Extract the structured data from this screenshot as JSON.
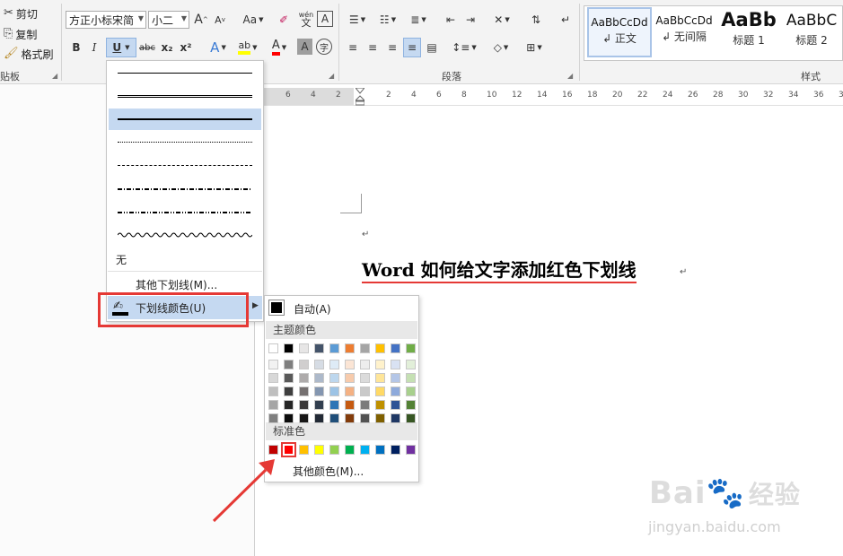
{
  "clipboard": {
    "cut": "剪切",
    "copy": "复制",
    "format_painter": "格式刷",
    "group_label": "贴板"
  },
  "font": {
    "name": "方正小标宋简",
    "size": "小二",
    "bold": "B",
    "italic": "I",
    "underline": "U",
    "strike": "abc",
    "subscript": "x₂",
    "superscript": "x²",
    "grow": "A",
    "shrink": "A",
    "change_case": "Aa",
    "phonetic": "wén",
    "char_border": "A",
    "text_effect": "A",
    "highlight": "ab",
    "font_color": "A",
    "char_shading": "A",
    "enclose": "字"
  },
  "paragraph": {
    "group_label": "段落"
  },
  "styles": {
    "group_label": "样式",
    "items": [
      {
        "sample": "AaBbCcDd",
        "name": "↲ 正文"
      },
      {
        "sample": "AaBbCcDd",
        "name": "↲ 无间隔"
      },
      {
        "sample": "AaBb",
        "name": "标题 1"
      },
      {
        "sample": "AaBbC",
        "name": "标题 2"
      }
    ]
  },
  "ruler": {
    "left_numbers": [
      "6",
      "4",
      "2"
    ],
    "right_numbers": [
      "2",
      "4",
      "6",
      "8",
      "10",
      "12",
      "14",
      "16",
      "18",
      "20",
      "22",
      "24",
      "26",
      "28",
      "30",
      "32",
      "34",
      "36",
      "38"
    ]
  },
  "underline_menu": {
    "none_label": "无",
    "more_label": "其他下划线(M)...",
    "color_label": "下划线颜色(U)"
  },
  "color_menu": {
    "auto_label": "自动(A)",
    "theme_title": "主题颜色",
    "standard_title": "标准色",
    "more_label": "其他颜色(M)...",
    "theme_top": [
      "#ffffff",
      "#000000",
      "#e7e6e6",
      "#44546a",
      "#5b9bd5",
      "#ed7d31",
      "#a5a5a5",
      "#ffc000",
      "#4472c4",
      "#70ad47"
    ],
    "theme_shades": [
      [
        "#f2f2f2",
        "#7f7f7f",
        "#d0cece",
        "#d6dce4",
        "#deebf6",
        "#fbe5d5",
        "#ededed",
        "#fff2cc",
        "#d9e2f3",
        "#e2efd9"
      ],
      [
        "#d8d8d8",
        "#595959",
        "#aeabab",
        "#adb9ca",
        "#bdd7ee",
        "#f7cbac",
        "#dbdbdb",
        "#fee599",
        "#b4c6e7",
        "#c5e0b3"
      ],
      [
        "#bfbfbf",
        "#3f3f3f",
        "#757070",
        "#8496b0",
        "#9cc3e5",
        "#f4b183",
        "#c9c9c9",
        "#ffd965",
        "#8eaadb",
        "#a8d08d"
      ],
      [
        "#a5a5a5",
        "#262626",
        "#3a3838",
        "#323f4f",
        "#2e75b5",
        "#c55a11",
        "#7b7b7b",
        "#bf9000",
        "#2f5496",
        "#538135"
      ],
      [
        "#7f7f7f",
        "#0c0c0c",
        "#171616",
        "#222a35",
        "#1f4e79",
        "#833c0b",
        "#525252",
        "#7f6000",
        "#1f3864",
        "#375623"
      ]
    ],
    "standard": [
      "#c00000",
      "#ff0000",
      "#ffc000",
      "#ffff00",
      "#92d050",
      "#00b050",
      "#00b0f0",
      "#0070c0",
      "#002060",
      "#7030a0"
    ],
    "selected_standard_index": 1
  },
  "document": {
    "paragraph_mark": "↵",
    "title_latin": "Word",
    "title_cn": " 如何给文字添加红色下划线",
    "underline_color": "#e53935"
  },
  "watermark": {
    "brand_latin": "Bai",
    "brand_cn": "经验",
    "url": "jingyan.baidu.com"
  },
  "accent": {
    "red_annotation": "#e53935",
    "selection_blue": "#c5d9f1"
  }
}
